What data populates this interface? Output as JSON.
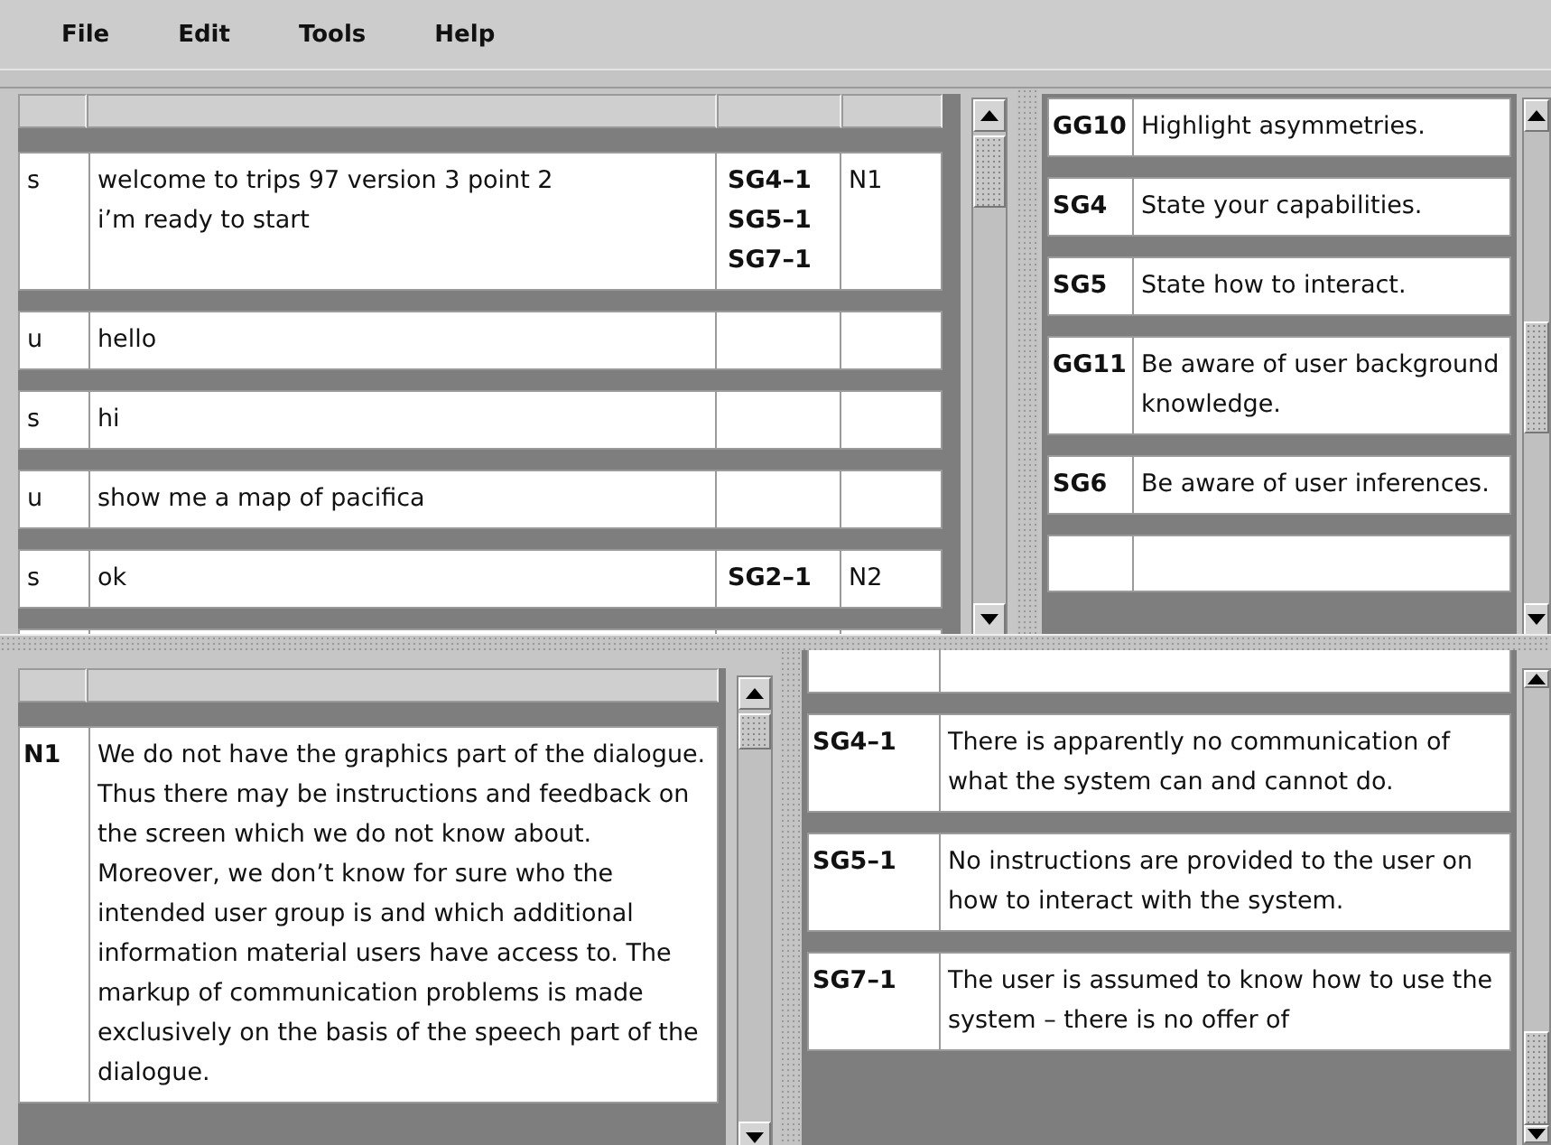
{
  "menu": [
    {
      "label": "File"
    },
    {
      "label": "Edit"
    },
    {
      "label": "Tools"
    },
    {
      "label": "Help"
    }
  ],
  "dialogue_table": {
    "rows": [
      {
        "speaker": "s",
        "utterance": "welcome to trips 97 version 3 point 2\ni’m ready to start",
        "problems": [
          "SG4–1",
          "SG5–1",
          "SG7–1"
        ],
        "note": "N1"
      },
      {
        "speaker": "u",
        "utterance": "hello",
        "problems": []
      },
      {
        "speaker": "s",
        "utterance": "hi",
        "problems": []
      },
      {
        "speaker": "u",
        "utterance": "show me a map of pacifica",
        "problems": []
      },
      {
        "speaker": "s",
        "utterance": "ok",
        "problems": [
          "SG2–1"
        ],
        "note": "N2"
      }
    ]
  },
  "guidelines_table": {
    "rows": [
      {
        "code": "GG10",
        "text": "Highlight asymmetries."
      },
      {
        "code": "SG4",
        "text": "State your capabilities."
      },
      {
        "code": "SG5",
        "text": "State how to interact."
      },
      {
        "code": "GG11",
        "text": "Be aware of user background knowledge."
      },
      {
        "code": "SG6",
        "text": "Be aware of user inferences."
      }
    ]
  },
  "notes_table": {
    "rows": [
      {
        "code": "N1",
        "text": "We do not have the graphics part of the dialogue. Thus there may be instructions and feedback on the screen which we do not know about. Moreover, we don’t know for sure who the intended user group is and which additional information material users have access to. The markup of communication problems is made exclusively on the basis of the speech part of the dialogue."
      }
    ]
  },
  "problems_table": {
    "rows": [
      {
        "code": "SG4–1",
        "text": "There is apparently no communication of what the system can and cannot do."
      },
      {
        "code": "SG5–1",
        "text": "No instructions are provided to the user on how to interact with the system."
      },
      {
        "code": "SG7–1",
        "text": "The user is assumed to know how to use the system – there is no offer of"
      }
    ]
  }
}
